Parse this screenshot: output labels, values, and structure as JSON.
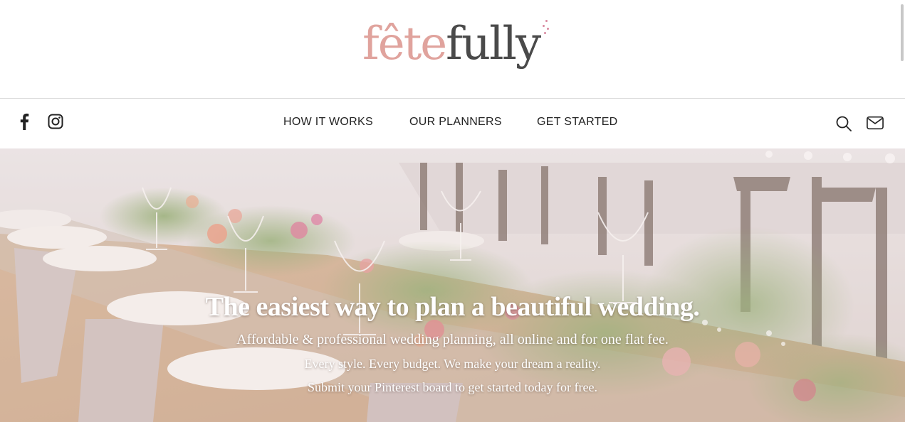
{
  "brand": {
    "logo_part1": "fête",
    "logo_part2": "fully",
    "colors": {
      "pink": "#e0a39d",
      "dark": "#4a4a4a",
      "text": "#222222"
    }
  },
  "nav": {
    "social": [
      {
        "icon": "facebook-icon"
      },
      {
        "icon": "instagram-icon"
      }
    ],
    "links": [
      "HOW IT WORKS",
      "OUR PLANNERS",
      "GET STARTED"
    ],
    "utilities": [
      {
        "icon": "search-icon"
      },
      {
        "icon": "mail-icon"
      }
    ]
  },
  "hero": {
    "headline": "The easiest way to plan a beautiful wedding.",
    "line1": "Affordable & professional wedding planning, all online and for one flat fee.",
    "line2": "Every style. Every budget. We make your dream a reality.",
    "line3": "Submit your Pinterest board to get started today for free."
  }
}
